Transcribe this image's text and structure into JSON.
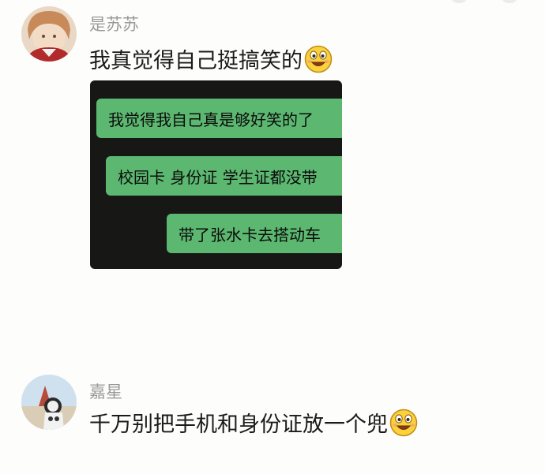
{
  "comments": [
    {
      "username": "是苏苏",
      "text": "我真觉得自己挺搞笑的",
      "emoji": "grinning-face-emoji",
      "chat_screenshot": {
        "messages": [
          "我觉得我自己真是够好笑的了",
          "校园卡 身份证 学生证都没带",
          "带了张水卡去搭动车"
        ]
      }
    },
    {
      "username": "嘉星",
      "text": "千万别把手机和身份证放一个兜",
      "emoji": "grinning-face-emoji"
    }
  ],
  "colors": {
    "background": "#fdfdfb",
    "username": "#9a9a9a",
    "text": "#1b1b1b",
    "chat_bg": "#171716",
    "bubble": "#5cb870"
  }
}
